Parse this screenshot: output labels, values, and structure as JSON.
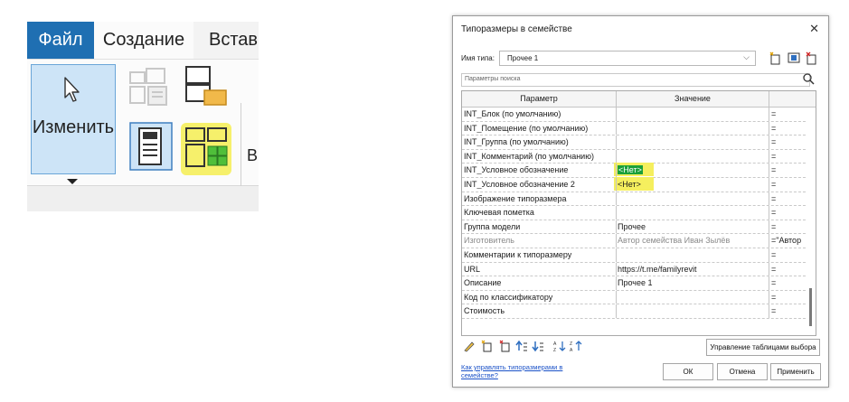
{
  "ribbon": {
    "tab_file": "Файл",
    "tab_create": "Создание",
    "tab_insert": "Встав",
    "modify_label": "Изменить",
    "cut_text": "Вı"
  },
  "dialog": {
    "title": "Типоразмеры в семействе",
    "close": "✕",
    "type_name_label": "Имя типа:",
    "type_name_value": "Прочее 1",
    "search_placeholder": "Параметры поиска",
    "col_param": "Параметр",
    "col_value": "Значение",
    "rows": [
      {
        "param": "INT_Блок (по умолчанию)",
        "value": "",
        "formula": "="
      },
      {
        "param": "INT_Помещение (по умолчанию)",
        "value": "",
        "formula": "="
      },
      {
        "param": "INT_Группа (по умолчанию)",
        "value": "",
        "formula": "="
      },
      {
        "param": "INT_Комментарий (по умолчанию)",
        "value": "",
        "formula": "="
      },
      {
        "param": "INT_Условное обозначение",
        "value": "<Нет>",
        "formula": "="
      },
      {
        "param": "INT_Условное обозначение 2",
        "value": "<Нет>",
        "formula": "="
      },
      {
        "param": "Изображение типоразмера",
        "value": "",
        "formula": "="
      },
      {
        "param": "Ключевая пометка",
        "value": "",
        "formula": "="
      },
      {
        "param": "Группа модели",
        "value": "Прочее",
        "formula": "="
      },
      {
        "param": "Изготовитель",
        "value": "Автор семейства Иван Зылёв",
        "formula": "=\"Автор"
      },
      {
        "param": "Комментарии к типоразмеру",
        "value": "",
        "formula": "="
      },
      {
        "param": "URL",
        "value": "https://t.me/familyrevit",
        "formula": "="
      },
      {
        "param": "Описание",
        "value": "Прочее 1",
        "formula": "="
      },
      {
        "param": "Код по классификатору",
        "value": "",
        "formula": "="
      },
      {
        "param": "Стоимость",
        "value": "",
        "formula": "="
      }
    ],
    "manage_lookup": "Управление таблицами выбора",
    "help_link": "Как управлять типоразмерами в семействе?",
    "ok": "ОК",
    "cancel": "Отмена",
    "apply": "Применить"
  },
  "colors": {
    "file_tab": "#1f6fb2",
    "highlight": "#f5ef5e",
    "tag_green": "#1aa03a"
  }
}
